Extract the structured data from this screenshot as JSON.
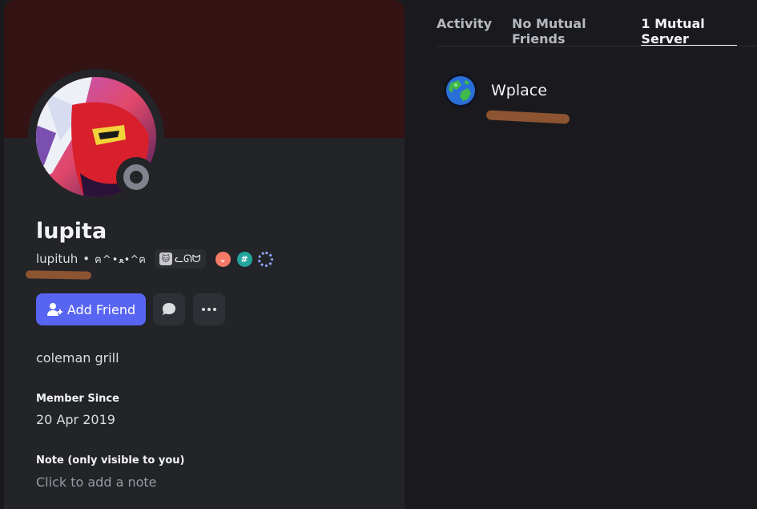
{
  "profile": {
    "display_name": "lupita",
    "username": "lupituh",
    "separator": "•",
    "pronouns": "ฅ^•ﻌ•^ฅ",
    "tag_text": "ᓚᘏᗢ",
    "badges": [
      "hypesquad-icon",
      "hash-badge-icon",
      "ring-badge-icon"
    ]
  },
  "actions": {
    "add_friend_label": "Add Friend"
  },
  "bio": "coleman grill",
  "member_since": {
    "title": "Member Since",
    "date": "20 Apr 2019"
  },
  "note": {
    "title": "Note (only visible to you)",
    "placeholder": "Click to add a note"
  },
  "tabs": [
    {
      "label": "Activity",
      "active": false
    },
    {
      "label": "No Mutual Friends",
      "active": false
    },
    {
      "label": "1 Mutual Server",
      "active": true
    }
  ],
  "mutual_servers": [
    {
      "name": "Wplace",
      "icon": "globe-icon"
    }
  ],
  "colors": {
    "accent": "#5865f2",
    "banner": "#331314",
    "status_offline": "#80848e"
  }
}
